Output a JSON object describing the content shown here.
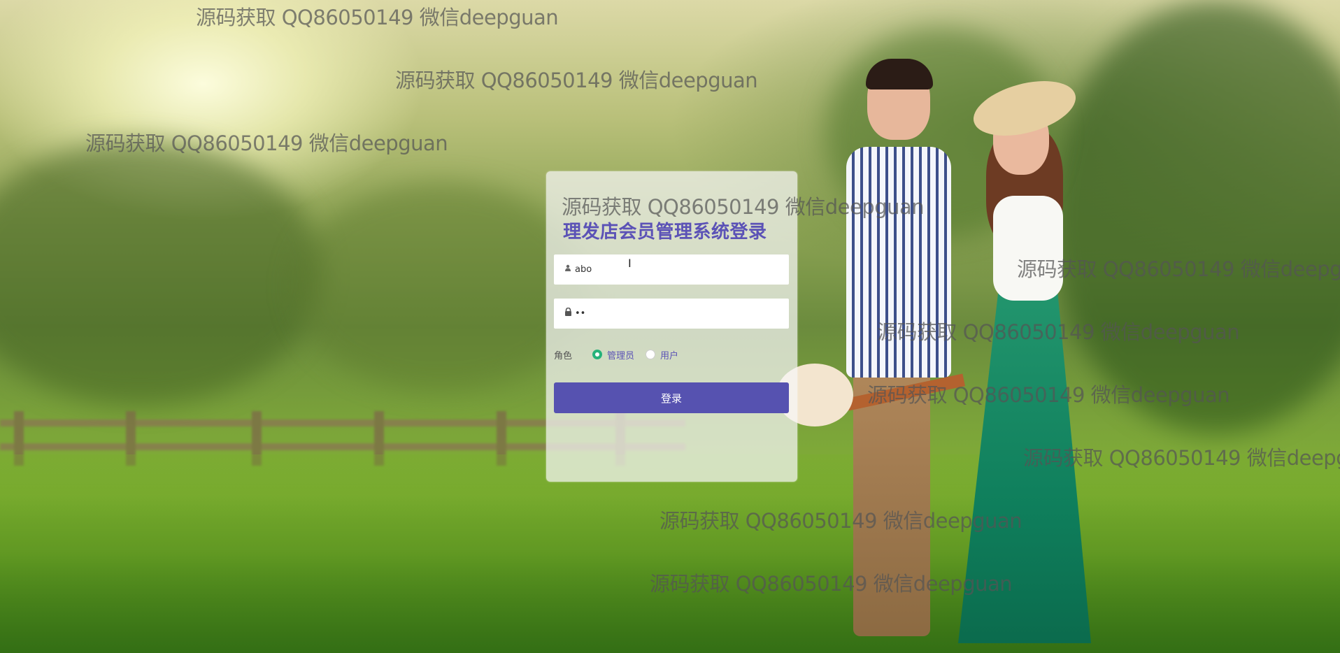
{
  "login": {
    "title": "理发店会员管理系统登录",
    "username_value": "abo",
    "password_value": "••",
    "role_label": "角色",
    "roles": [
      {
        "label": "管理员",
        "selected": true
      },
      {
        "label": "用户",
        "selected": false
      }
    ],
    "submit_label": "登录"
  },
  "watermark_text": "源码获取 QQ86050149 微信deepguan",
  "icons": {
    "username": "user-icon",
    "password": "lock-icon"
  },
  "colors": {
    "title": "#5b52b6",
    "button": "#5652b0",
    "radio_selected": "#26b27a"
  }
}
